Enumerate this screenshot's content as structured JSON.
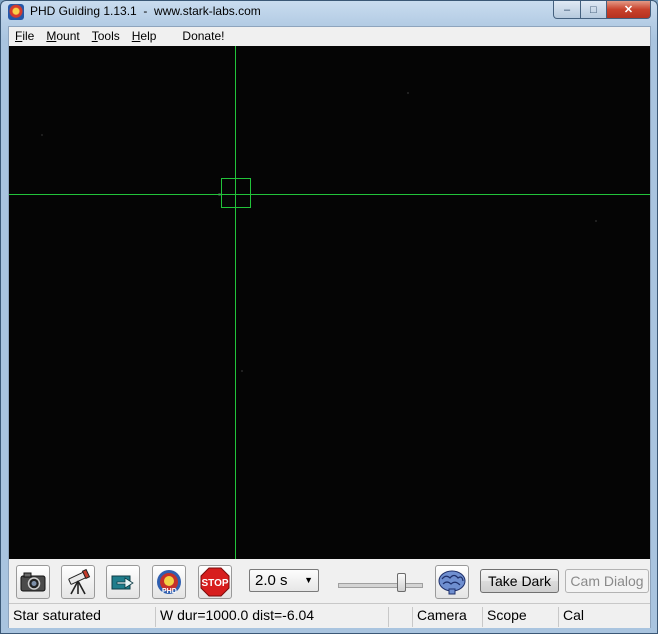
{
  "window": {
    "title": "PHD Guiding 1.13.1  -  www.stark-labs.com"
  },
  "caption_buttons": {
    "minimize": "–",
    "maximize": "□",
    "close": "✕"
  },
  "menu": {
    "file": "File",
    "mount": "Mount",
    "tools": "Tools",
    "help": "Help",
    "donate": "Donate!"
  },
  "toolbar": {
    "exposure": "2.0 s",
    "exposure_options": [
      "2.0 s"
    ],
    "take_dark": "Take Dark",
    "cam_dialog": "Cam Dialog",
    "icons": [
      "camera-icon",
      "telescope-icon",
      "loop-arrow-icon",
      "phd-guide-icon",
      "stop-icon",
      "brain-icon"
    ],
    "stop_text": "STOP",
    "gamma_slider_fraction": 0.75
  },
  "status": {
    "message": "Star saturated",
    "guide": "W dur=1000.0 dist=-6.04",
    "extra": "",
    "camera": "Camera",
    "scope": "Scope",
    "cal": "Cal"
  },
  "colors": {
    "crosshair": "#22c33a",
    "view_background": "#050505"
  }
}
